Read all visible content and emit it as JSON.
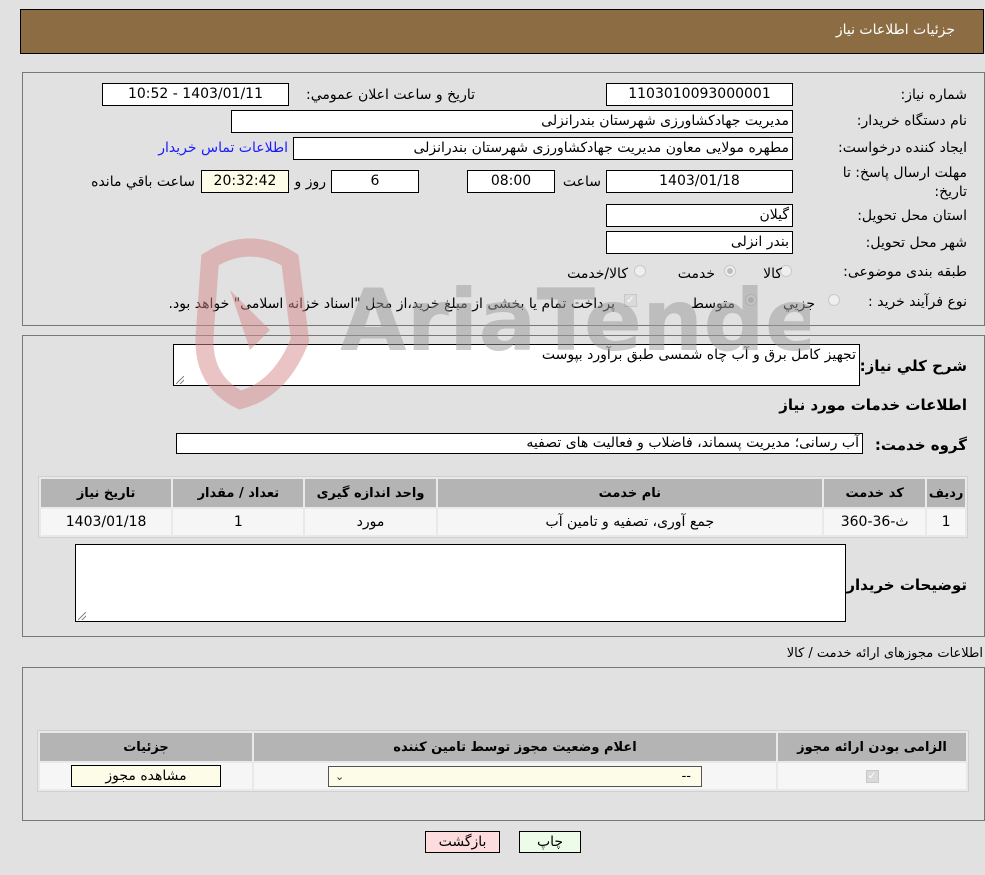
{
  "header": {
    "title": "جزئیات اطلاعات نیاز"
  },
  "form": {
    "need_number": {
      "label": "شماره نیاز:",
      "value": "1103010093000001"
    },
    "announce_datetime": {
      "label": "تاریخ و ساعت اعلان عمومي:",
      "value": "1403/01/11 - 10:52"
    },
    "buyer_org": {
      "label": "نام دستگاه خریدار:",
      "value": "مدیریت جهادکشاورزی شهرستان بندرانزلی"
    },
    "requester": {
      "label": "ایجاد کننده درخواست:",
      "value": "مطهره مولایی معاون مدیریت جهادکشاورزی شهرستان بندرانزلی"
    },
    "buyer_contact_link": "اطلاعات تماس خریدار",
    "deadline": {
      "label": "مهلت ارسال پاسخ: تا تاریخ:",
      "date": "1403/01/18",
      "time_label": "ساعت",
      "time": "08:00",
      "days": "6",
      "days_label": "روز و",
      "remaining": "20:32:42",
      "remaining_label": "ساعت باقي مانده"
    },
    "province": {
      "label": "استان محل تحویل:",
      "value": "گیلان"
    },
    "city": {
      "label": "شهر محل تحویل:",
      "value": "بندر انزلی"
    },
    "category": {
      "label": "طبقه بندی موضوعی:",
      "options": [
        "کالا",
        "خدمت",
        "کالا/خدمت"
      ],
      "selected": "خدمت"
    },
    "purchase_process": {
      "label": "نوع فرآیند خرید :",
      "options": [
        "جزيي",
        "متوسط"
      ],
      "selected": "متوسط",
      "treasury_note": "پرداخت تمام یا بخشی از مبلغ خرید،از محل \"اسناد خزانه اسلامی\" خواهد بود.",
      "treasury_checked": true
    }
  },
  "description": {
    "label": "شرح کلي نیاز:",
    "value": "تجهیز کامل برق و آب چاه شمسی طبق برآورد بپوست"
  },
  "services_section_title": "اطلاعات خدمات مورد نیاز",
  "service_group": {
    "label": "گروه خدمت:",
    "value": "آب رسانی؛ مدیریت پسماند، فاضلاب و فعالیت های تصفیه"
  },
  "services_table": {
    "columns": [
      "ردیف",
      "کد خدمت",
      "نام خدمت",
      "واحد اندازه گیری",
      "تعداد / مقدار",
      "تاریخ نیاز"
    ],
    "rows": [
      [
        "1",
        "ث-36-360",
        "جمع آوری، تصفیه و تامین آب",
        "مورد",
        "1",
        "1403/01/18"
      ]
    ]
  },
  "buyer_notes": {
    "label": "توضیحات خریدار:",
    "value": ""
  },
  "permits_section_title": "اطلاعات مجوزهای ارائه خدمت / کالا",
  "permits_table": {
    "columns": [
      "الزامی بودن ارائه مجوز",
      "اعلام وضعیت مجوز توسط تامین کننده",
      "جزئیات"
    ],
    "rows": [
      {
        "required": true,
        "status_selected": "--",
        "details_button": "مشاهده مجوز"
      }
    ]
  },
  "buttons": {
    "print": "چاپ",
    "back": "بازگشت"
  },
  "watermark": "AriaTender.neT"
}
